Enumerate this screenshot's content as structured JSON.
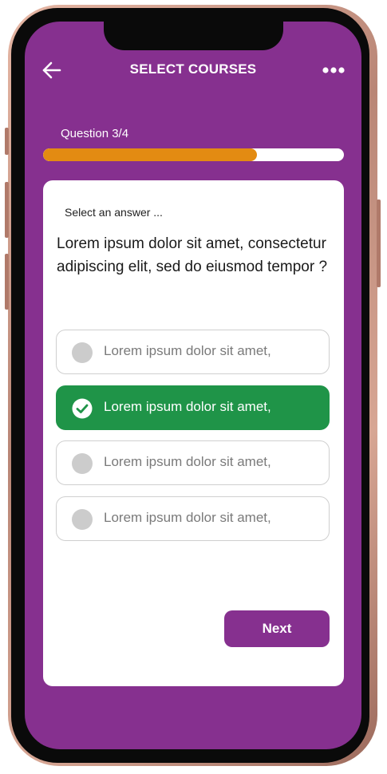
{
  "header": {
    "title": "SELECT COURSES",
    "back_icon": "arrow-left-icon",
    "more_icon": "more-horizontal-icon"
  },
  "progress": {
    "label": "Question 3/4",
    "fraction": 0.71,
    "fill_color": "#e38b12",
    "track_color": "#ffffff"
  },
  "quiz": {
    "prompt": "Select an answer ...",
    "question": "Lorem ipsum dolor sit amet, consectetur adipiscing elit, sed do eiusmod tempor ?",
    "options": [
      {
        "label": "Lorem ipsum dolor sit amet,",
        "selected": false
      },
      {
        "label": "Lorem ipsum dolor sit amet,",
        "selected": true
      },
      {
        "label": "Lorem ipsum dolor sit amet,",
        "selected": false
      },
      {
        "label": "Lorem ipsum dolor sit amet,",
        "selected": false
      }
    ],
    "next_label": "Next"
  },
  "colors": {
    "brand": "#86308f",
    "selected": "#1f9448",
    "radio_inactive": "#cccccc"
  }
}
